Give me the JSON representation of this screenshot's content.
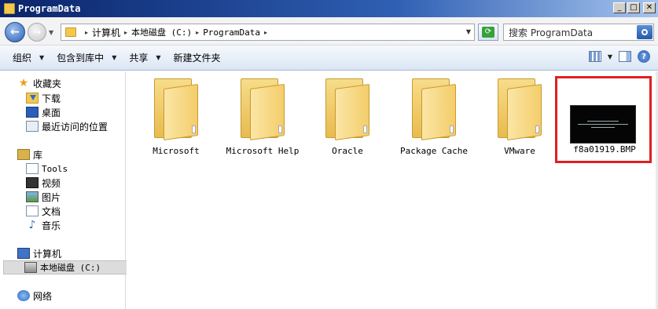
{
  "window": {
    "title": "ProgramData"
  },
  "address": {
    "crumbs": [
      "计算机",
      "本地磁盘 (C:)",
      "ProgramData"
    ]
  },
  "search": {
    "placeholder": "搜索 ProgramData"
  },
  "toolbar": {
    "organize": "组织",
    "include_in_library": "包含到库中",
    "share": "共享",
    "new_folder": "新建文件夹"
  },
  "nav": {
    "favorites": "收藏夹",
    "downloads": "下载",
    "desktop": "桌面",
    "recent": "最近访问的位置",
    "libraries": "库",
    "tools": "Tools",
    "videos": "视频",
    "pictures": "图片",
    "documents": "文档",
    "music": "音乐",
    "computer": "计算机",
    "local_disk": "本地磁盘 (C:)",
    "network": "网络"
  },
  "files": [
    {
      "name": "Microsoft",
      "type": "folder"
    },
    {
      "name": "Microsoft Help",
      "type": "folder"
    },
    {
      "name": "Oracle",
      "type": "folder"
    },
    {
      "name": "Package Cache",
      "type": "folder"
    },
    {
      "name": "VMware",
      "type": "folder"
    },
    {
      "name": "f8a01919.BMP",
      "type": "bmp-image"
    }
  ],
  "colors": {
    "highlight_border": "#e02020",
    "title_bar": "#0a246a"
  }
}
